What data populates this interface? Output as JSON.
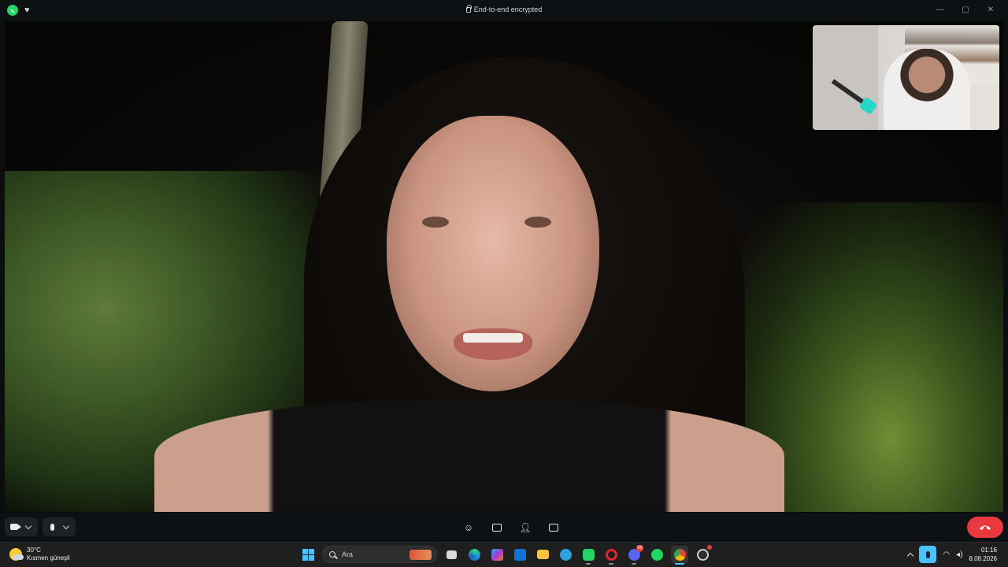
{
  "titlebar": {
    "encryption_text": "End-to-end encrypted",
    "app_icon": "whatsapp-icon",
    "favorite_icon": "heart-icon",
    "window_controls": [
      "minimize",
      "maximize",
      "close"
    ]
  },
  "call": {
    "controls": {
      "left": [
        {
          "name": "camera-toggle",
          "icon": "camera-icon"
        },
        {
          "name": "microphone-toggle",
          "icon": "microphone-icon"
        }
      ],
      "center": [
        {
          "name": "reactions",
          "icon": "emoji-icon"
        },
        {
          "name": "screen-share",
          "icon": "screen-share-icon"
        },
        {
          "name": "add-participant",
          "icon": "add-person-icon"
        },
        {
          "name": "more-options",
          "icon": "menu-icon"
        }
      ],
      "end_call_icon": "end-call-icon"
    },
    "colors": {
      "end_call": "#e8393f",
      "whatsapp": "#25d366"
    }
  },
  "taskbar": {
    "weather": {
      "temp": "30°C",
      "condition": "Kısmen güneşli"
    },
    "search": {
      "placeholder": "Ara"
    },
    "apps": [
      {
        "name": "file-explorer-multitask",
        "icon": "task-view-icon"
      },
      {
        "name": "edge",
        "icon": "edge-icon"
      },
      {
        "name": "copilot",
        "icon": "copilot-icon"
      },
      {
        "name": "outlook",
        "icon": "outlook-icon"
      },
      {
        "name": "explorer",
        "icon": "folder-icon"
      },
      {
        "name": "telegram",
        "icon": "telegram-icon"
      },
      {
        "name": "whatsapp",
        "icon": "whatsapp-icon"
      },
      {
        "name": "opera",
        "icon": "opera-icon"
      },
      {
        "name": "discord",
        "icon": "discord-icon",
        "badge": "99"
      },
      {
        "name": "spotify",
        "icon": "spotify-icon"
      },
      {
        "name": "chrome",
        "icon": "chrome-icon"
      },
      {
        "name": "obs",
        "icon": "obs-icon"
      }
    ],
    "clock": {
      "time": "01:16",
      "date": "8.08.2026"
    }
  }
}
